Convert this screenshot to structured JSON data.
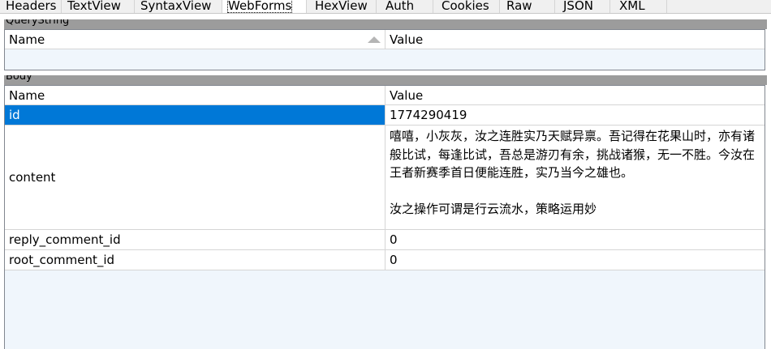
{
  "tabs": [
    {
      "label": "Headers",
      "active": false
    },
    {
      "label": "TextView",
      "active": false
    },
    {
      "label": "SyntaxView",
      "active": false
    },
    {
      "label": "WebForms",
      "active": true
    },
    {
      "label": "HexView",
      "active": false
    },
    {
      "label": "Auth",
      "active": false
    },
    {
      "label": "Cookies",
      "active": false
    },
    {
      "label": "Raw",
      "active": false
    },
    {
      "label": "JSON",
      "active": false
    },
    {
      "label": "XML",
      "active": false
    }
  ],
  "querystring": {
    "title": "QueryString",
    "col_name": "Name",
    "col_value": "Value",
    "sort_icon": "sort-ascending-icon",
    "rows": []
  },
  "body": {
    "title": "Body",
    "col_name": "Name",
    "col_value": "Value",
    "rows": [
      {
        "name": "id",
        "value": "1774290419",
        "selected": true
      },
      {
        "name": "content",
        "value": "嘻嘻，小灰灰，汝之连胜实乃天赋异禀。吾记得在花果山时，亦有诸般比试，每逢比试，吾总是游刃有余，挑战诸猴，无一不胜。今汝在王者新赛季首日便能连胜，实乃当今之雄也。\n\n汝之操作可谓是行云流水，策略运用妙",
        "selected": false
      },
      {
        "name": "reply_comment_id",
        "value": "0",
        "selected": false
      },
      {
        "name": "root_comment_id",
        "value": "0",
        "selected": false
      }
    ]
  },
  "colors": {
    "selection": "#0078d7",
    "group_header": "#9c9c9c",
    "grid_background": "#f0f6fc"
  }
}
